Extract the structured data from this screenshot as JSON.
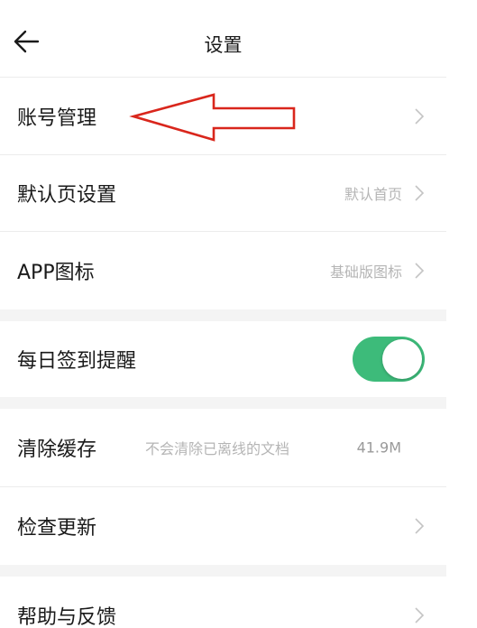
{
  "header": {
    "title": "设置",
    "back_icon": "arrow-left-icon"
  },
  "rows": {
    "account": {
      "label": "账号管理",
      "value": ""
    },
    "default_page": {
      "label": "默认页设置",
      "value": "默认首页"
    },
    "app_icon": {
      "label": "APP图标",
      "value": "基础版图标"
    },
    "checkin": {
      "label": "每日签到提醒",
      "toggle_on": true
    },
    "cache": {
      "label": "清除缓存",
      "hint": "不会清除已离线的文档",
      "size": "41.9M"
    },
    "update": {
      "label": "检查更新",
      "value": ""
    },
    "help": {
      "label": "帮助与反馈",
      "value": ""
    }
  },
  "colors": {
    "toggle_on": "#3dbb7a",
    "annotation_arrow": "#d9261c",
    "gap_bg": "#f4f4f4"
  },
  "annotation": {
    "type": "arrow",
    "points_to": "account-row"
  }
}
